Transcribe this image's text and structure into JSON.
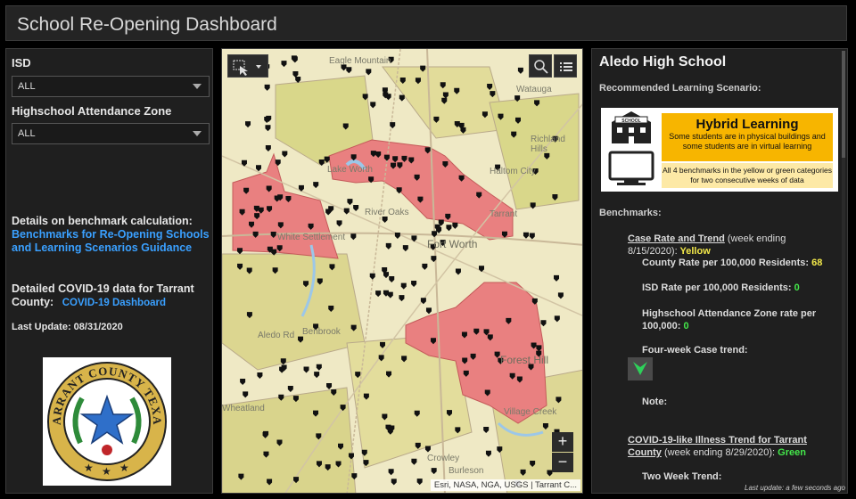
{
  "header": {
    "title": "School Re-Opening Dashboard"
  },
  "filters": {
    "isd_label": "ISD",
    "isd_value": "ALL",
    "zone_label": "Highschool Attendance Zone",
    "zone_value": "ALL"
  },
  "info": {
    "details_label": "Details on benchmark calculation:",
    "details_link": "Benchmarks for Re-Opening Schools and Learning Scenarios Guidance",
    "covid_label": "Detailed COVID-19 data for Tarrant County:",
    "covid_link": "COVID-19 Dashboard",
    "last_update": "Last Update: 08/31/2020"
  },
  "seal": {
    "text": "TARRANT COUNTY TEXAS",
    "colors": {
      "ring": "#d8b44a",
      "star": "#2f6fc9",
      "leaves": "#2e8b3a"
    }
  },
  "map": {
    "places": [
      "Eagle Mountain",
      "Lake Worth",
      "White Settlement",
      "River Oaks",
      "Fort Worth",
      "Haltom City",
      "Richland Hills",
      "Watauga",
      "Benbrook",
      "Aledo Rd",
      "Wheatland",
      "Forest Hill",
      "Crowley",
      "Burleson",
      "Tarrant",
      "Village Creek"
    ],
    "attribution": "Esri, NASA, NGA, USGS | Tarrant C...",
    "zoom_in": "+",
    "zoom_out": "−",
    "colors": {
      "base": "#efe9c5",
      "zone": "#d9d78a",
      "red": "#e98080",
      "dot": "#111111"
    }
  },
  "detail": {
    "school": "Aledo High School",
    "scenario_label": "Recommended Learning Scenario:",
    "scenario": {
      "title": "Hybrid Learning",
      "desc": "Some students are in physical buildings and some students are in virtual learning",
      "note": "All 4 benchmarks in the yellow or green categories for two consecutive weeks of data",
      "school_sign": "SCHOOL"
    },
    "benchmarks_label": "Benchmarks:",
    "case_link": "Case Rate and Trend",
    "case_period": "(week ending 8/15/2020):",
    "case_status": "Yellow",
    "county_rate_label": "County Rate per 100,000 Residents:",
    "county_rate_value": "68",
    "isd_rate_label": "ISD Rate per 100,000 Residents:",
    "isd_rate_value": "0",
    "zone_rate_label": "Highschool Attendance Zone rate per 100,000:",
    "zone_rate_value": "0",
    "trend_label": "Four-week Case trend:",
    "note_label": "Note:",
    "cli_link": "COVID-19-like Illness Trend for Tarrant County",
    "cli_period": "(week ending 8/29/2020):",
    "cli_status": "Green",
    "two_week_label": "Two Week Trend:",
    "footer": "Last update: a few seconds ago"
  }
}
